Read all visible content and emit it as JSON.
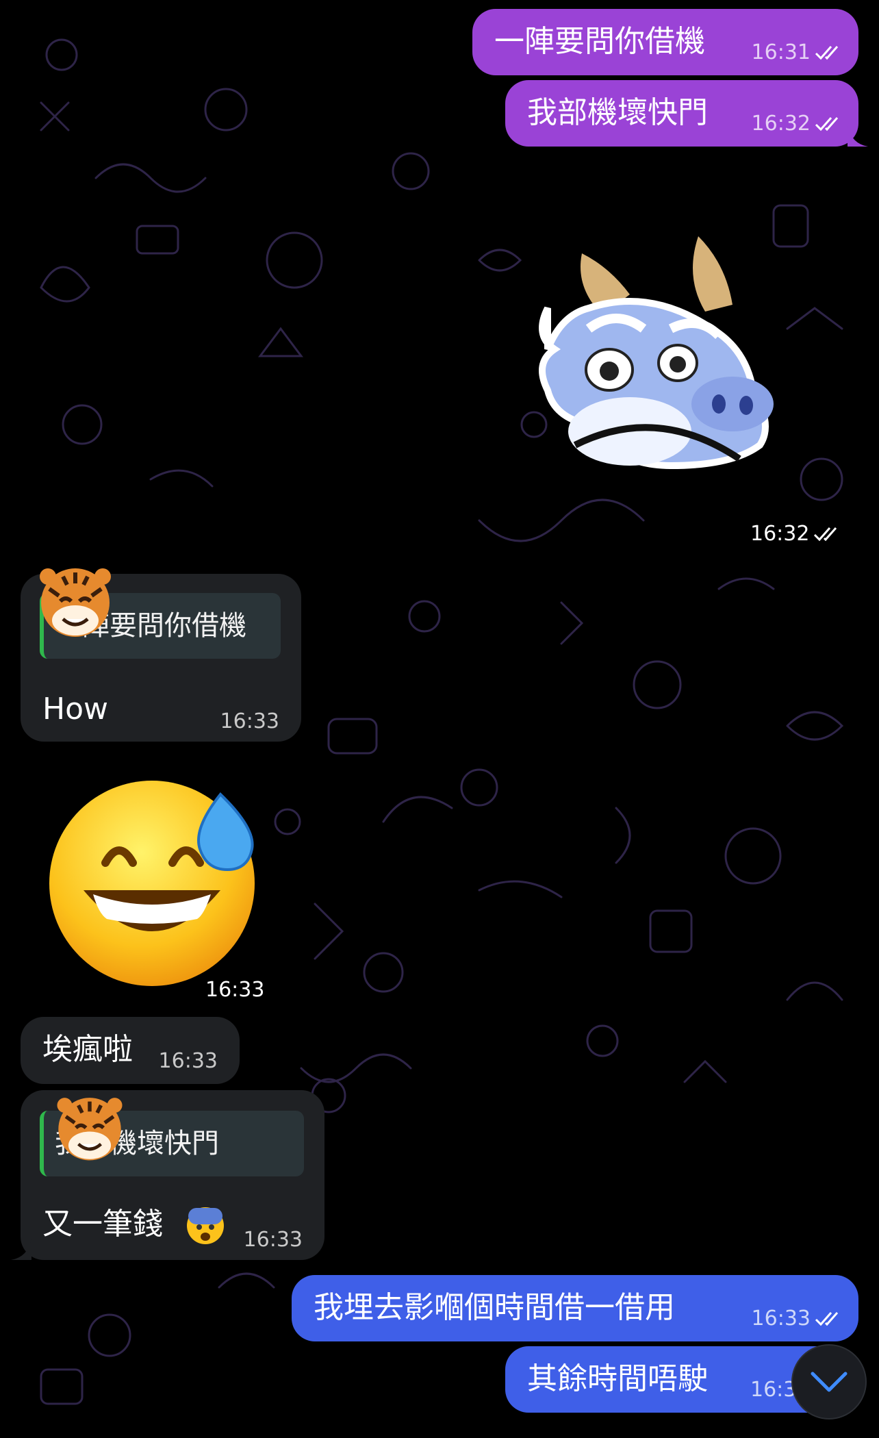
{
  "colors": {
    "background": "#000000",
    "outgoing_purple": "#9a43d6",
    "outgoing_blue": "#3f5fe8",
    "incoming": "#1f2124",
    "reply_bar": "#2fb84c",
    "doodle": "#3a2b5c"
  },
  "messages": [
    {
      "id": "m1",
      "direction": "outgoing",
      "text": "一陣要問你借機",
      "time": "16:31",
      "status": "read"
    },
    {
      "id": "m2",
      "direction": "outgoing",
      "text": "我部機壞快門",
      "time": "16:32",
      "status": "read"
    },
    {
      "id": "m3",
      "direction": "outgoing",
      "type": "sticker",
      "sticker": "worried-dragon-sticker",
      "time": "16:32",
      "status": "read"
    },
    {
      "id": "m4",
      "direction": "incoming",
      "avatar": "tiger-avatar",
      "reply_to": "一陣要問你借機",
      "text": "How",
      "time": "16:33"
    },
    {
      "id": "m5",
      "direction": "incoming",
      "type": "sticker",
      "sticker": "grinning-sweat-emoji",
      "time": "16:33"
    },
    {
      "id": "m6",
      "direction": "incoming",
      "text": "埃瘋啦",
      "time": "16:33"
    },
    {
      "id": "m7",
      "direction": "incoming",
      "avatar": "tiger-avatar",
      "reply_to": "我部機壞快門",
      "text": "又一筆錢",
      "emoji": "anxious-face-emoji",
      "time": "16:33"
    },
    {
      "id": "m8",
      "direction": "outgoing",
      "text": "我埋去影嗰個時間借一借用",
      "time": "16:33",
      "status": "read"
    },
    {
      "id": "m9",
      "direction": "outgoing",
      "text": "其餘時間唔駛",
      "time": "16:3",
      "status": "read"
    }
  ],
  "scroll_button": {
    "icon": "chevron-down-icon"
  }
}
